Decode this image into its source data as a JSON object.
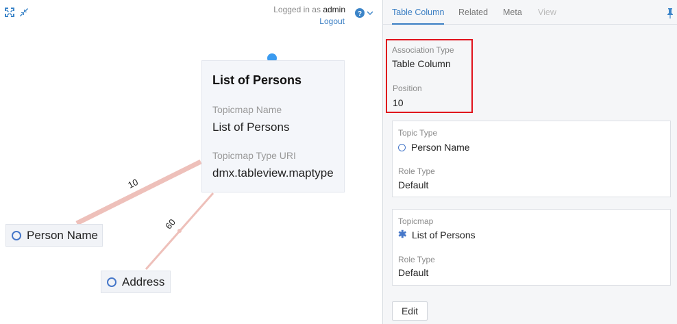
{
  "toolbar": {
    "expand_icon": "fullscreen-icon",
    "shrink_icon": "compress-icon",
    "logged_in_prefix": "Logged in as",
    "username": "admin",
    "logout_label": "Logout",
    "help_icon": "help-icon",
    "dropdown_icon": "chevron-down-icon"
  },
  "canvas": {
    "edges": [
      {
        "label": "10"
      },
      {
        "label": "60"
      }
    ],
    "nodes": [
      {
        "label": "Person Name",
        "icon": "circle-icon"
      },
      {
        "label": "Address",
        "icon": "circle-icon"
      }
    ],
    "detail": {
      "title": "List of Persons",
      "fields": [
        {
          "label": "Topicmap Name",
          "value": "List of Persons"
        },
        {
          "label": "Topicmap Type URI",
          "value": "dmx.tableview.maptype"
        }
      ]
    }
  },
  "panel": {
    "tabs": [
      {
        "label": "Table Column",
        "state": "active"
      },
      {
        "label": "Related",
        "state": "normal"
      },
      {
        "label": "Meta",
        "state": "normal"
      },
      {
        "label": "View",
        "state": "disabled"
      }
    ],
    "pin_icon": "pin-icon",
    "association_type_label": "Association Type",
    "association_type_value": "Table Column",
    "position_label": "Position",
    "position_value": "10",
    "players": [
      {
        "label1": "Topic Type",
        "value1": "Person Name",
        "icon": "circle-icon",
        "label2": "Role Type",
        "value2": "Default"
      },
      {
        "label1": "Topicmap",
        "value1": "List of Persons",
        "icon": "asterisk-icon",
        "label2": "Role Type",
        "value2": "Default"
      }
    ],
    "edit_label": "Edit"
  },
  "colors": {
    "accent": "#3a7ec3",
    "edge": "#f0c3bd",
    "highlight_box": "#e0121c",
    "node_ring": "#4677c9"
  }
}
